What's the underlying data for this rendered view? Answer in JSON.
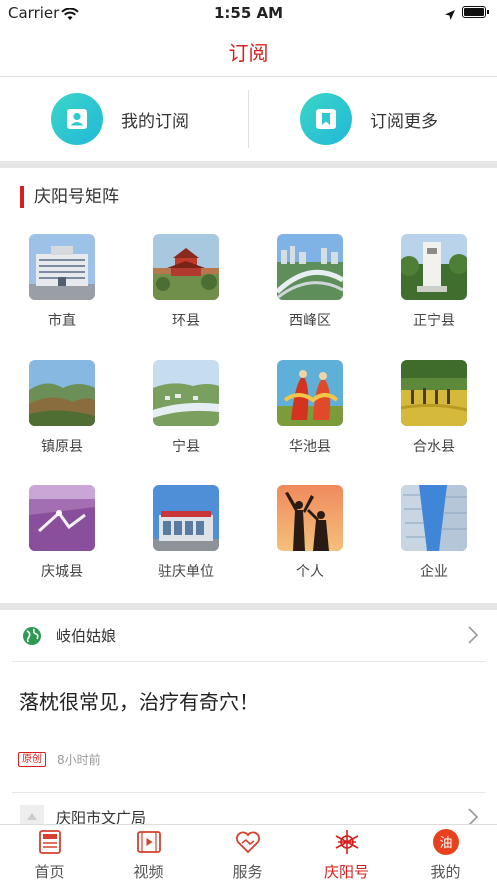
{
  "status_bar": {
    "carrier": "Carrier",
    "time": "1:55 AM"
  },
  "nav": {
    "title": "订阅"
  },
  "subscribe": {
    "mine_label": "我的订阅",
    "more_label": "订阅更多"
  },
  "matrix": {
    "title": "庆阳号矩阵",
    "items": [
      {
        "label": "市直"
      },
      {
        "label": "环县"
      },
      {
        "label": "西峰区"
      },
      {
        "label": "正宁县"
      },
      {
        "label": "镇原县"
      },
      {
        "label": "宁县"
      },
      {
        "label": "华池县"
      },
      {
        "label": "合水县"
      },
      {
        "label": "庆城县"
      },
      {
        "label": "驻庆单位"
      },
      {
        "label": "个人"
      },
      {
        "label": "企业"
      }
    ]
  },
  "feed": {
    "source1": "岐伯姑娘",
    "headline": "落枕很常见，治疗有奇穴！",
    "badge": "原创",
    "time_ago": "8小时前",
    "source2": "庆阳市文广局"
  },
  "tabs": [
    {
      "label": "首页",
      "icon": "news-icon"
    },
    {
      "label": "视频",
      "icon": "video-icon"
    },
    {
      "label": "服务",
      "icon": "service-heart-icon"
    },
    {
      "label": "庆阳号",
      "icon": "qingyang-star-icon"
    },
    {
      "label": "我的",
      "icon": "profile-oil-icon",
      "badge_text": "油"
    }
  ],
  "colors": {
    "accent": "#d81e1e",
    "teal": "#2ec8cf"
  }
}
